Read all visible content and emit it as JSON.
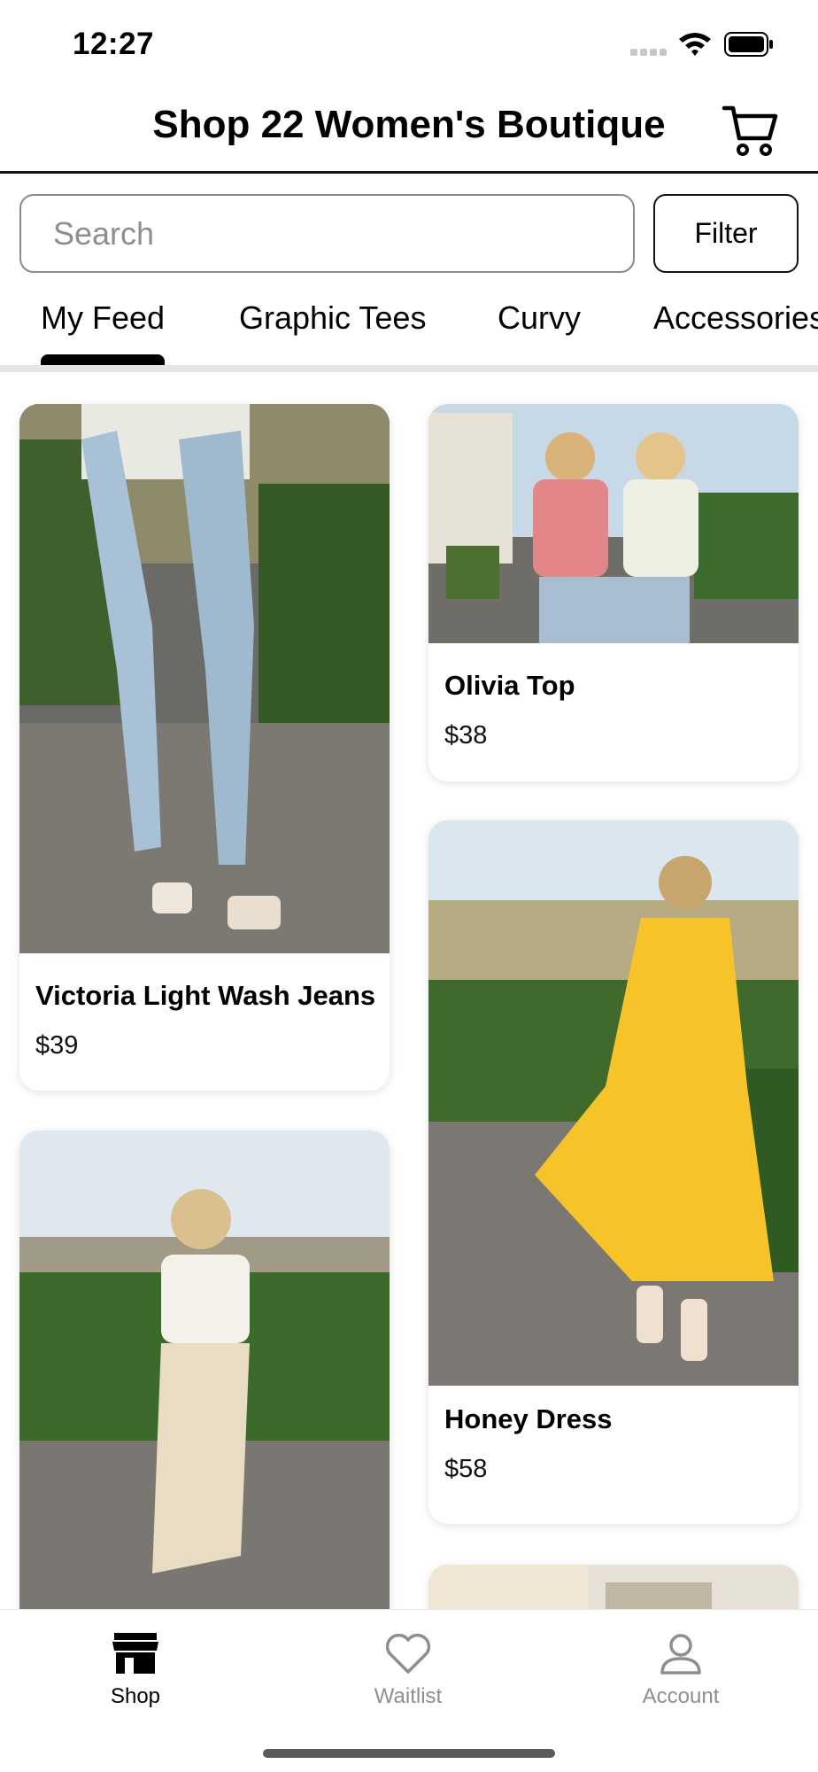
{
  "status_bar": {
    "time": "12:27"
  },
  "header": {
    "title": "Shop 22 Women's Boutique",
    "cart_icon": "cart-icon"
  },
  "search": {
    "placeholder": "Search",
    "value": ""
  },
  "filter": {
    "label": "Filter"
  },
  "tabs": [
    {
      "label": "My Feed",
      "active": true
    },
    {
      "label": "Graphic Tees",
      "active": false
    },
    {
      "label": "Curvy",
      "active": false
    },
    {
      "label": "Accessories",
      "active": false
    }
  ],
  "products": [
    {
      "name": "Victoria Light Wash Jeans",
      "price": "$39"
    },
    {
      "name": "Olivia Top",
      "price": "$38"
    },
    {
      "name": "Honey Dress",
      "price": "$58"
    }
  ],
  "bottom_nav": [
    {
      "label": "Shop",
      "icon": "store-icon",
      "active": true
    },
    {
      "label": "Waitlist",
      "icon": "heart-icon",
      "active": false
    },
    {
      "label": "Account",
      "icon": "person-icon",
      "active": false
    }
  ],
  "colors": {
    "active": "#000000",
    "inactive": "#8e8e8e",
    "tab_underline": "#e6e6e6"
  }
}
